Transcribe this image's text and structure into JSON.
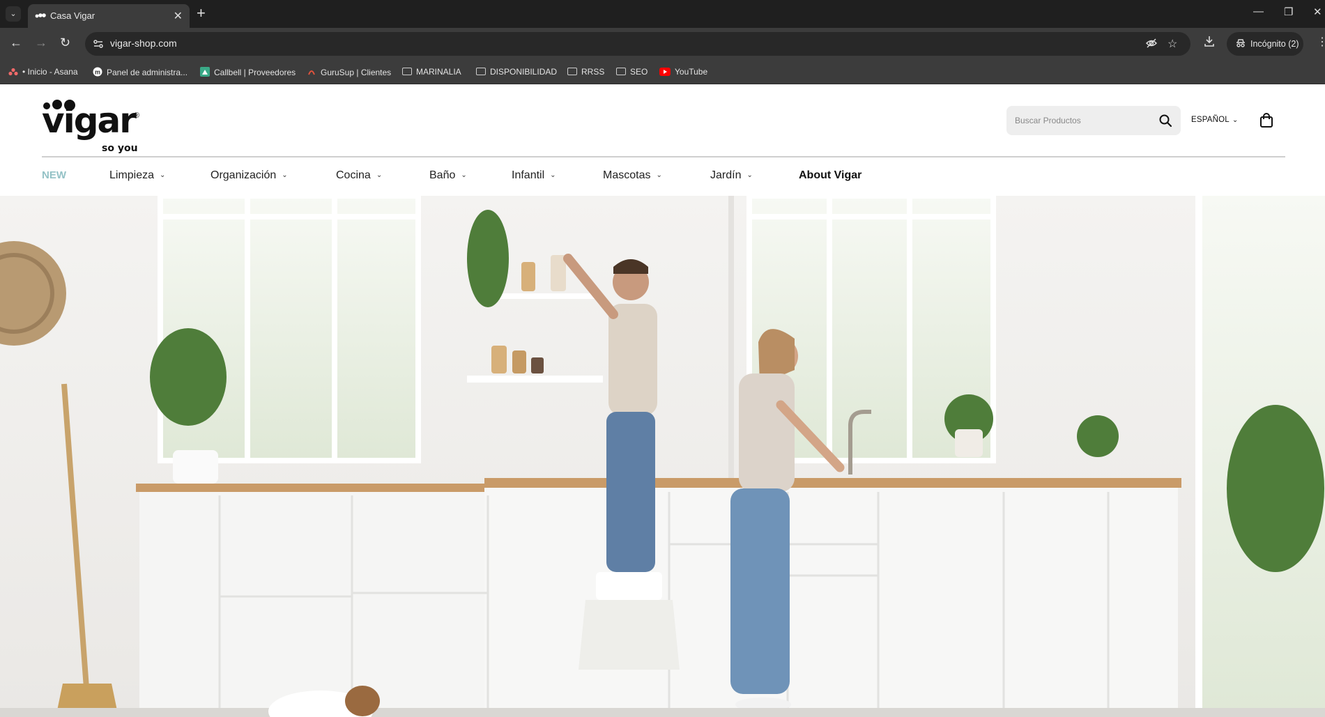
{
  "browser": {
    "tab_title": "Casa Vigar",
    "url": "vigar-shop.com",
    "incognito_label": "Incógnito (2)",
    "bookmarks": [
      {
        "label": "• Inicio - Asana",
        "icon": "asana-icon"
      },
      {
        "label": "Panel de administra...",
        "icon": "m-logo-icon"
      },
      {
        "label": "Callbell | Proveedores",
        "icon": "callbell-icon"
      },
      {
        "label": "GuruSup | Clientes",
        "icon": "gurusup-icon"
      },
      {
        "label": "MARINALIA",
        "icon": "folder-icon"
      },
      {
        "label": "DISPONIBILIDAD",
        "icon": "folder-icon"
      },
      {
        "label": "RRSS",
        "icon": "folder-icon"
      },
      {
        "label": "SEO",
        "icon": "folder-icon"
      },
      {
        "label": "YouTube",
        "icon": "youtube-icon"
      }
    ]
  },
  "site": {
    "logo_word": "vigar",
    "logo_tagline": "so you",
    "logo_mark": "®",
    "search_placeholder": "Buscar Productos",
    "language": "ESPAÑOL",
    "nav": [
      {
        "label": "NEW",
        "dropdown": false
      },
      {
        "label": "Limpieza",
        "dropdown": true
      },
      {
        "label": "Organización",
        "dropdown": true
      },
      {
        "label": "Cocina",
        "dropdown": true
      },
      {
        "label": "Baño",
        "dropdown": true
      },
      {
        "label": "Infantil",
        "dropdown": true
      },
      {
        "label": "Mascotas",
        "dropdown": true
      },
      {
        "label": "Jardín",
        "dropdown": true
      },
      {
        "label": "About Vigar",
        "dropdown": false
      }
    ]
  },
  "colors": {
    "accent_new": "#94c2c6",
    "chrome_dark": "#1f1f1f",
    "chrome_toolbar": "#3c3c3c"
  }
}
